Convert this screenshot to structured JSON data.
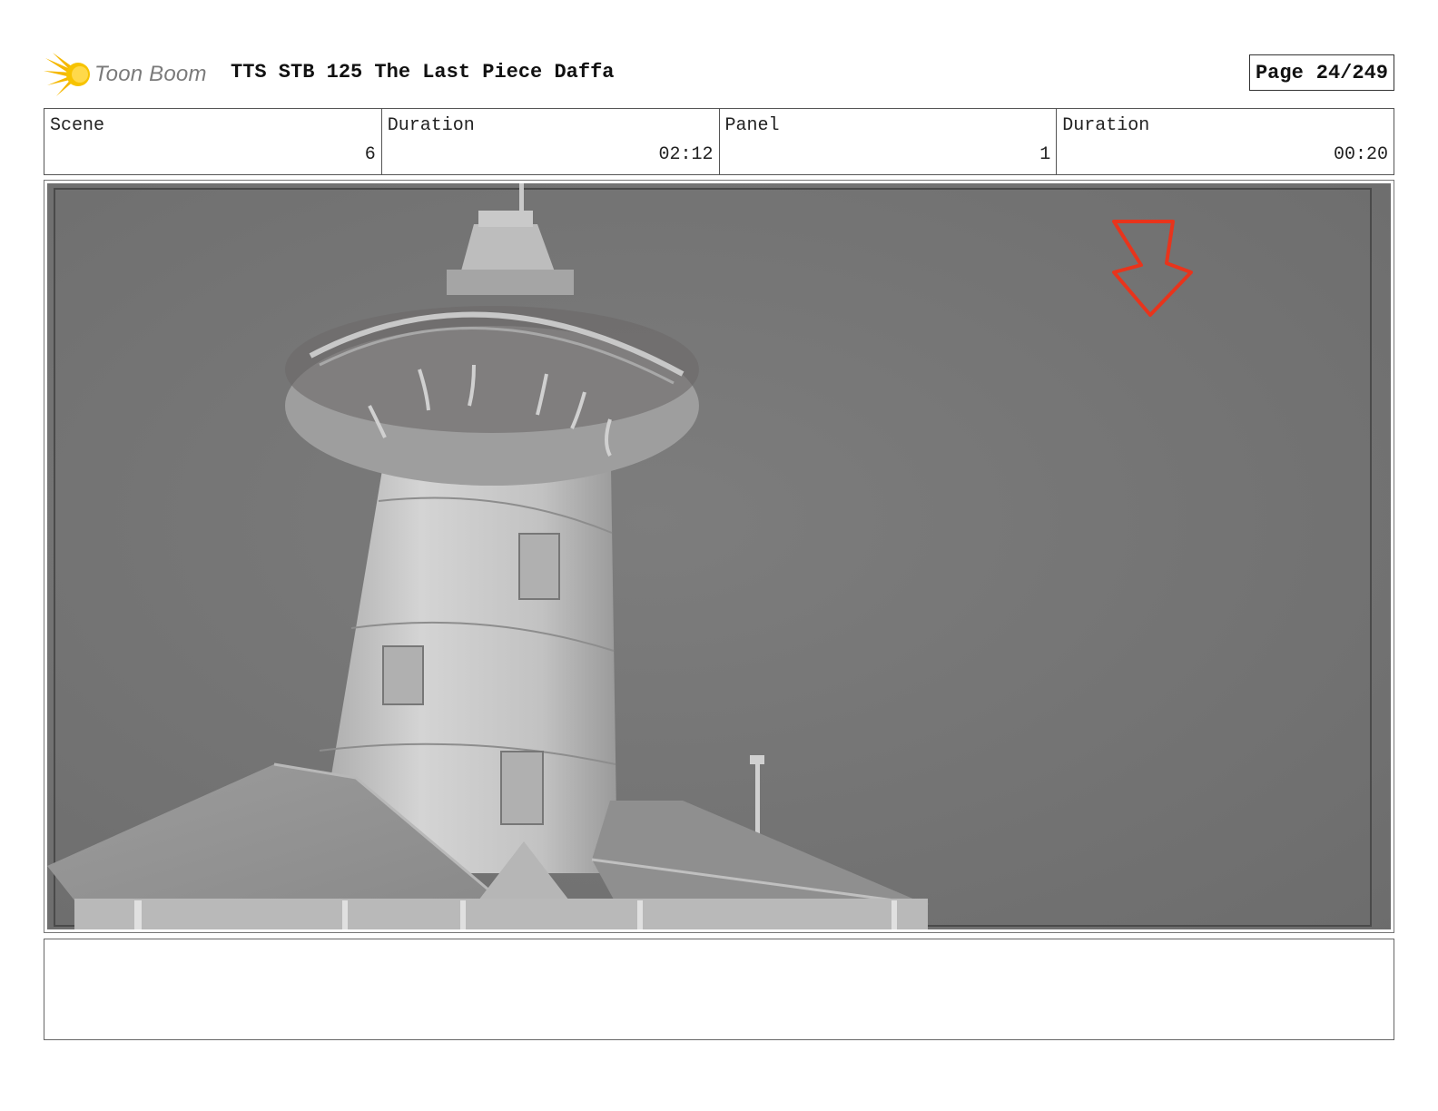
{
  "header": {
    "brand": "Toon Boom",
    "title": "TTS STB 125 The Last Piece Daffa",
    "page_label": "Page",
    "page_value": "24/249"
  },
  "info": {
    "scene_label": "Scene",
    "scene_value": "6",
    "scene_duration_label": "Duration",
    "scene_duration_value": "02:12",
    "panel_label": "Panel",
    "panel_value": "1",
    "panel_duration_label": "Duration",
    "panel_duration_value": "00:20"
  },
  "frame": {
    "subject": "lighthouse",
    "annotation": "red-down-arrow",
    "colors": {
      "sky": "#777777",
      "annotation": "#e8341c",
      "building": "#c4c4c4"
    }
  },
  "notes": {
    "text": ""
  }
}
